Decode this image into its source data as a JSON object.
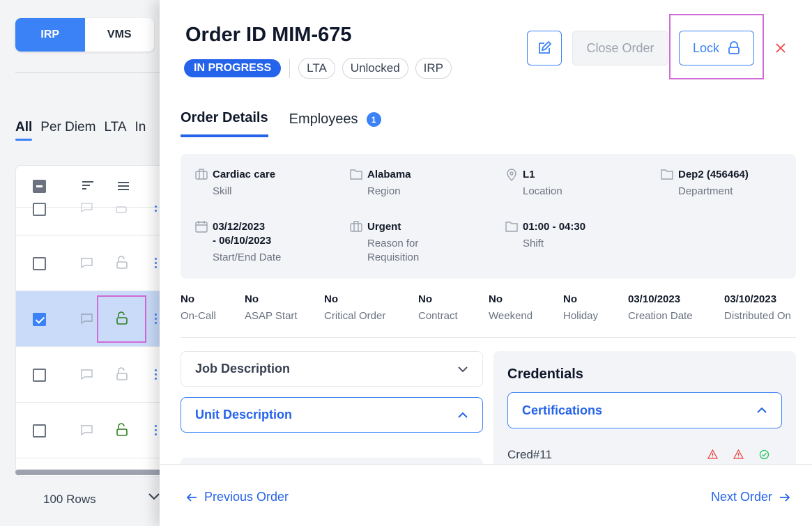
{
  "background": {
    "toggle": {
      "left": "IRP",
      "right": "VMS"
    },
    "tabs": [
      "All",
      "Per Diem",
      "LTA",
      "In"
    ],
    "rows_selector": "100 Rows"
  },
  "drawer": {
    "title": "Order ID MIM-675",
    "status": "IN PROGRESS",
    "chips": [
      "LTA",
      "Unlocked",
      "IRP"
    ],
    "buttons": {
      "close_order": "Close Order",
      "lock": "Lock"
    },
    "tabs": {
      "details": "Order Details",
      "employees": "Employees",
      "employees_count": "1"
    },
    "info": {
      "skill": {
        "value": "Cardiac care",
        "label": "Skill"
      },
      "region": {
        "value": "Alabama",
        "label": "Region"
      },
      "location": {
        "value": "L1",
        "label": "Location"
      },
      "department": {
        "value": "Dep2 (456464)",
        "label": "Department"
      },
      "dates": {
        "value1": "03/12/2023",
        "value2": "- 06/10/2023",
        "label": "Start/End Date"
      },
      "reason": {
        "value": "Urgent",
        "label1": "Reason for",
        "label2": "Requisition"
      },
      "shift": {
        "value": "01:00 - 04:30",
        "label": "Shift"
      }
    },
    "flags": [
      {
        "value": "No",
        "label": "On-Call"
      },
      {
        "value": "No",
        "label": "ASAP Start"
      },
      {
        "value": "No",
        "label": "Critical Order"
      },
      {
        "value": "No",
        "label": "Contract"
      },
      {
        "value": "No",
        "label": "Weekend"
      },
      {
        "value": "No",
        "label": "Holiday"
      },
      {
        "value": "03/10/2023",
        "label": "Creation Date"
      },
      {
        "value": "03/10/2023",
        "label": "Distributed On"
      }
    ],
    "job_description": "Job Description",
    "unit_description": "Unit Description",
    "credentials": {
      "title": "Credentials",
      "certifications": "Certifications",
      "item": "Cred#11"
    },
    "footer": {
      "prev": "Previous Order",
      "next": "Next Order"
    }
  },
  "colors": {
    "accent": "#3b82f6",
    "highlight": "#d16bd5",
    "warning": "#ef4444",
    "ok": "#22c55e"
  }
}
